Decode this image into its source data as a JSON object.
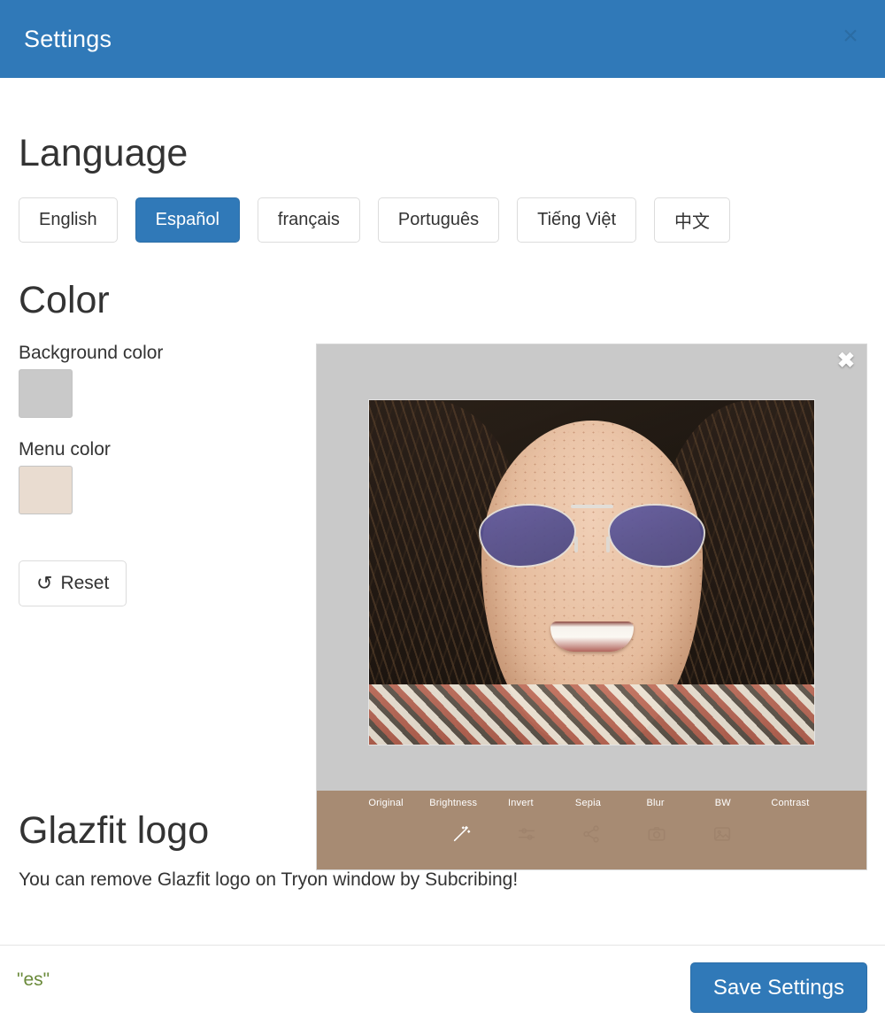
{
  "header": {
    "title": "Settings",
    "close_label": "×"
  },
  "language": {
    "heading": "Language",
    "selected": "Español",
    "options": [
      {
        "label": "English",
        "code": "en",
        "active": false
      },
      {
        "label": "Español",
        "code": "es",
        "active": true
      },
      {
        "label": "français",
        "code": "fr",
        "active": false
      },
      {
        "label": "Português",
        "code": "pt",
        "active": false
      },
      {
        "label": "Tiếng Việt",
        "code": "vi",
        "active": false
      },
      {
        "label": "中文",
        "code": "zh",
        "active": false
      }
    ]
  },
  "color": {
    "heading": "Color",
    "background_label": "Background color",
    "background_value": "#c9c9c9",
    "menu_label": "Menu color",
    "menu_value": "#e9dcd0",
    "reset_label": "Reset",
    "reset_icon": "undo-arrow-icon"
  },
  "preview": {
    "close_label": "✖",
    "background_value": "#c9c9c9",
    "toolbar_color": "#a78b73",
    "lens_color": "#5a5490",
    "filters": [
      {
        "label": "Original",
        "active": true
      },
      {
        "label": "Brightness",
        "active": false
      },
      {
        "label": "Invert",
        "active": false
      },
      {
        "label": "Sepia",
        "active": false
      },
      {
        "label": "Blur",
        "active": false
      },
      {
        "label": "BW",
        "active": false
      },
      {
        "label": "Contrast",
        "active": false
      }
    ],
    "tools": [
      {
        "name": "magic-wand-icon",
        "active": true
      },
      {
        "name": "sliders-icon",
        "active": false
      },
      {
        "name": "share-icon",
        "active": false
      },
      {
        "name": "camera-icon",
        "active": false
      },
      {
        "name": "gallery-icon",
        "active": false
      }
    ]
  },
  "logo_section": {
    "heading": "Glazfit logo",
    "note": "You can remove Glazfit logo on Tryon window by Subcribing!"
  },
  "footer": {
    "debug_value": "\"es\"",
    "save_label": "Save Settings"
  },
  "theme": {
    "primary": "#3079b8",
    "text": "#333333"
  }
}
